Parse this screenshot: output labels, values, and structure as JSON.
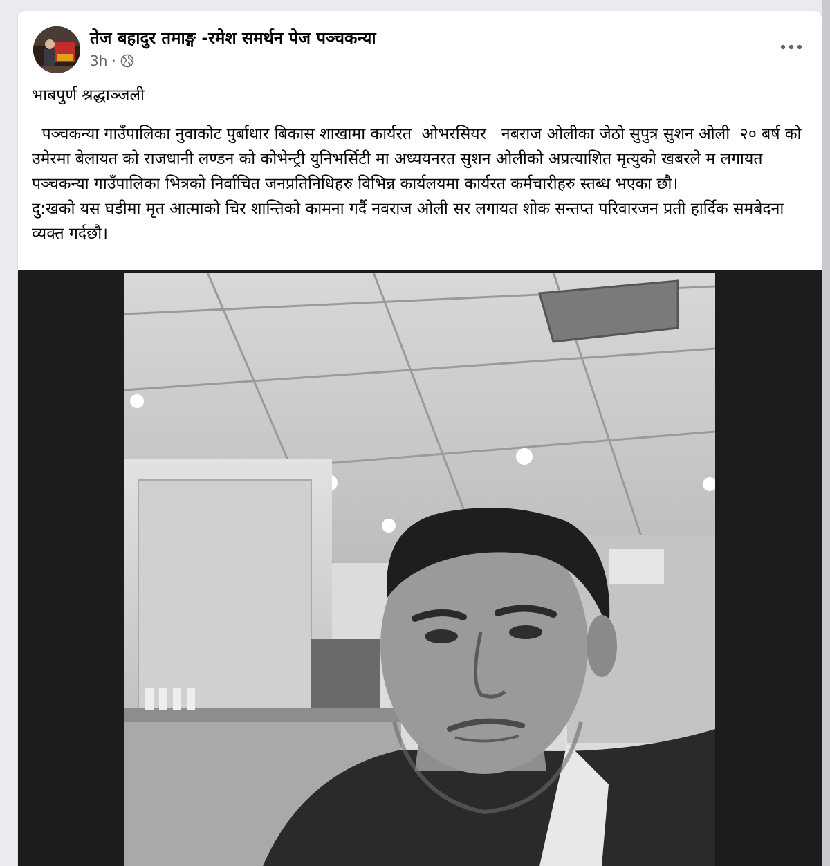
{
  "post": {
    "author": "तेज बहादुर तमाङ्ग -रमेश समर्थन पेज पञ्चकन्या",
    "time": "3h",
    "separator": "·",
    "privacy_icon": "globe-icon",
    "more_icon": "more-options-icon",
    "title": "भाबपुर्ण श्रद्धाञ्जली",
    "body": "  पञ्चकन्या गाउँपालिका नुवाकोट पुर्बाधार बिकास शाखामा कार्यरत  ओभरसियर   नबराज ओलीका जेठो सुपुत्र सुशन ओली  २० बर्ष को उमेरमा बेलायत को राजधानी लण्डन को कोभेन्ट्री युनिभर्सिटी मा अध्ययनरत सुशन ओलीको अप्रत्याशित मृत्युको खबरले म लगायत पञ्चकन्या गाउँपालिका भित्रको निर्वाचित जनप्रतिनिधिहरु विभिन्न कार्यलयमा कार्यरत कर्मचारीहरु स्तब्ध भएका छौ।\nदु:खको यस घडीमा मृत आत्माको चिर शान्तिको कामना गर्दै नवराज ओली सर लगायत शोक सन्तप्त परिवारजन प्रती हार्दिक समबेदना व्यक्त गर्दछौ।"
  },
  "colors": {
    "card_bg": "#ffffff",
    "page_bg": "#e9ebee",
    "text_primary": "#050505",
    "text_secondary": "#65676b",
    "media_bg": "#1c1c1c"
  }
}
